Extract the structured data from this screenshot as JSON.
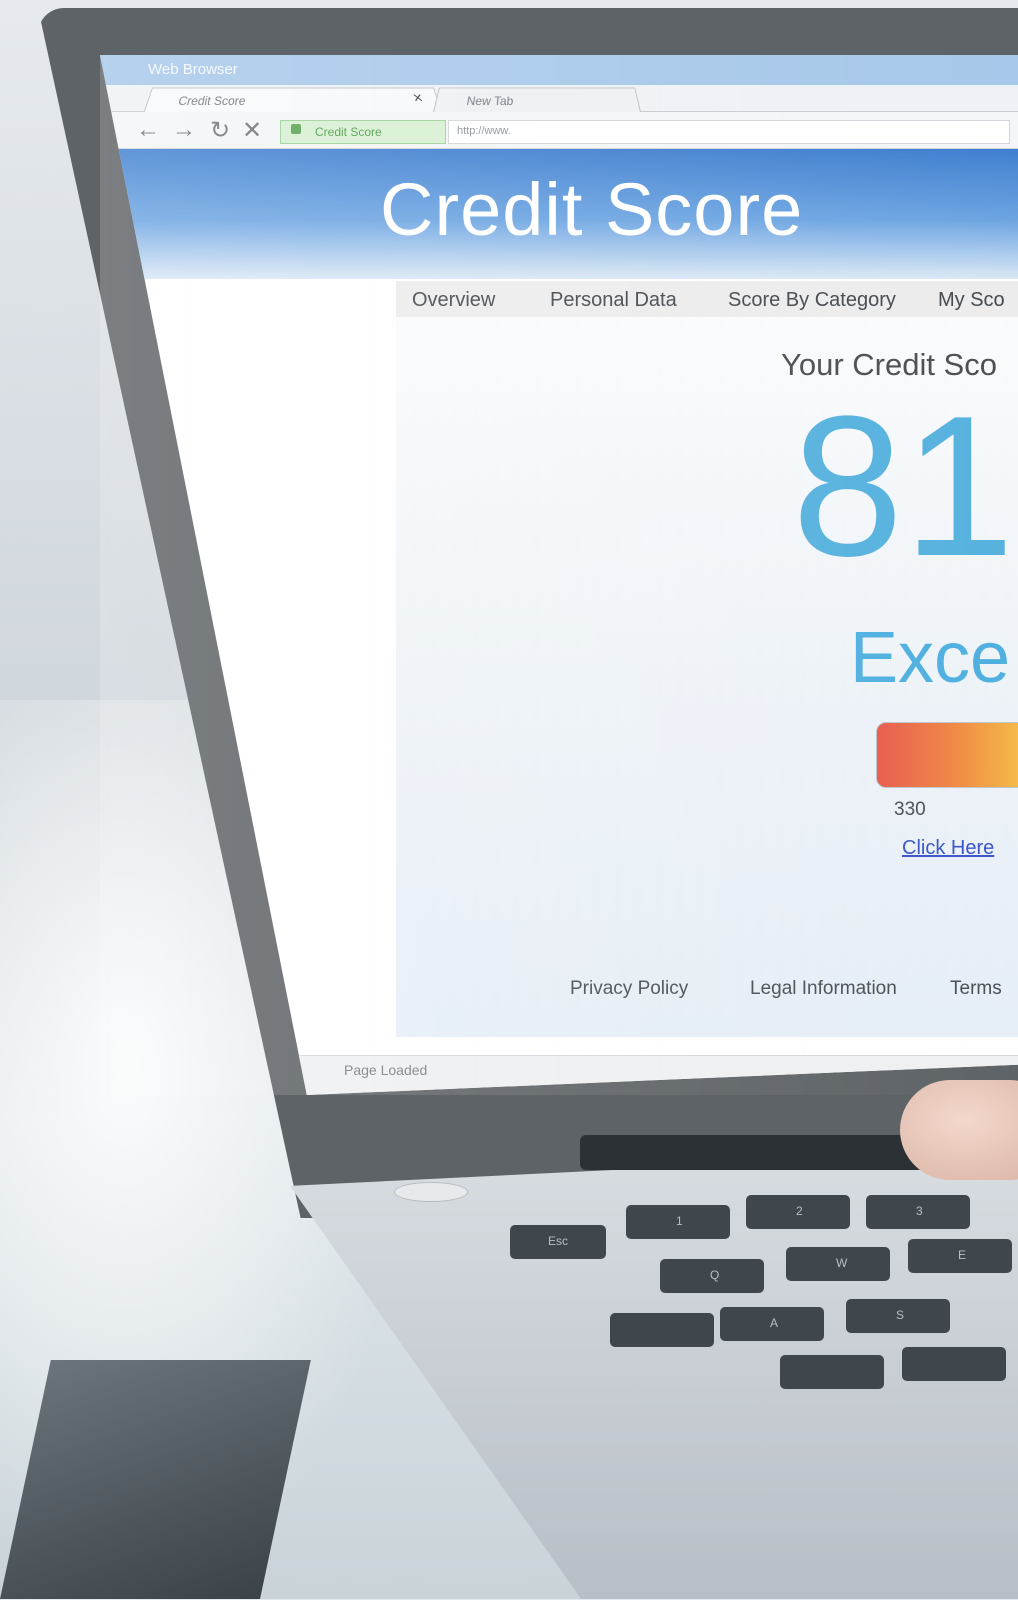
{
  "browser": {
    "window_title": "Web Browser",
    "tabs": [
      {
        "label": "Credit Score",
        "close_glyph": "×"
      },
      {
        "label": "New Tab"
      }
    ],
    "nav_icons": [
      "back-arrow-icon",
      "forward-arrow-icon",
      "reload-icon",
      "stop-icon"
    ],
    "secure_site_label": "Credit Score",
    "url": "http://www.",
    "status": "Page Loaded"
  },
  "page": {
    "banner_title": "Credit Score",
    "menu": [
      "Overview",
      "Personal Data",
      "Score By Category",
      "My Sco"
    ],
    "score_heading": "Your Credit Sco",
    "score_value": "81",
    "score_rating": "Exce",
    "score_range_min": "330",
    "cta_link": "Click Here",
    "footer_links": [
      "Privacy Policy",
      "Legal Information",
      "Terms"
    ]
  },
  "keyboard": {
    "keys": [
      "Esc",
      "1",
      "2",
      "3",
      "Q",
      "W",
      "E",
      "A",
      "S"
    ]
  },
  "colors": {
    "score_blue": "#56b2de",
    "banner_blue": "#3f7fcf",
    "secure_green": "#4c9b46",
    "gauge_low": "#e85a4f",
    "gauge_high": "#f7e84f"
  }
}
